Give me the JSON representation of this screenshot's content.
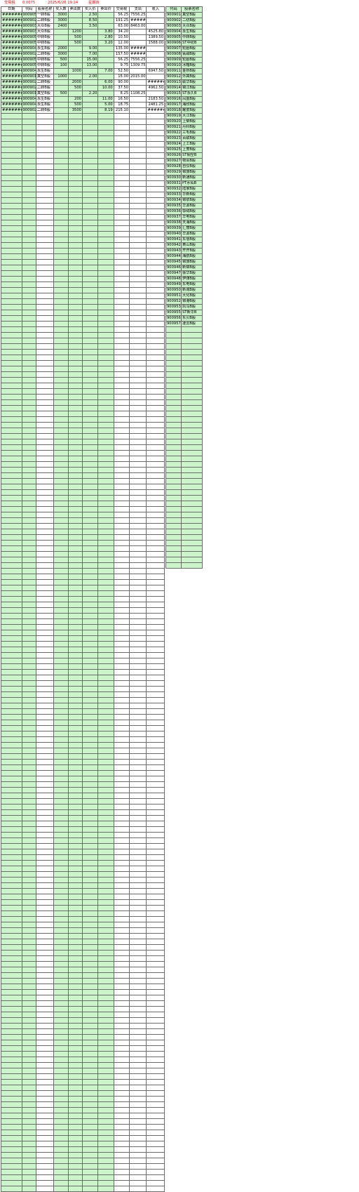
{
  "topbar": {
    "fee_label": "交易税",
    "fee_value": "0.0075",
    "datetime": "2025/6/26 19:24",
    "weekday": "星期四"
  },
  "main_sheet": {
    "headers": [
      "日期",
      "代码",
      "股票名称",
      "买入数",
      "卖出数",
      "买入价",
      "卖出价",
      "交易税",
      "支出",
      "收入"
    ],
    "rows": [
      [
        "########",
        "900905",
        "一转B股",
        "3000",
        "",
        "2.50",
        "",
        "56.25",
        "7556.25",
        ""
      ],
      [
        "########",
        "900902",
        "二转B股",
        "3000",
        "",
        "8.50",
        "",
        "191.25",
        "#######",
        ""
      ],
      [
        "########",
        "900903",
        "大众B股",
        "2400",
        "",
        "3.50",
        "",
        "63.00",
        "8463.00",
        ""
      ],
      [
        "########",
        "900903",
        "大众B股",
        "",
        "1200",
        "",
        "3.80",
        "34.20",
        "",
        "4525.80"
      ],
      [
        "########",
        "900905",
        "中转B股",
        "",
        "500",
        "",
        "2.80",
        "10.50",
        "",
        "1389.50"
      ],
      [
        "########",
        "900905",
        "中转B股",
        "",
        "500",
        "",
        "3.20",
        "12.00",
        "",
        "1588.00"
      ],
      [
        "########",
        "900904",
        "永生B股",
        "2000",
        "",
        "9.00",
        "",
        "135.00",
        "#######",
        ""
      ],
      [
        "########",
        "900902",
        "二转B股",
        "3000",
        "",
        "7.00",
        "",
        "157.50",
        "#######",
        ""
      ],
      [
        "########",
        "900905",
        "中转B股",
        "500",
        "",
        "15.00",
        "",
        "56.25",
        "7556.25",
        ""
      ],
      [
        "########",
        "900905",
        "中转B股",
        "100",
        "",
        "13.00",
        "",
        "9.75",
        "1309.75",
        ""
      ],
      [
        "########",
        "900904",
        "永生B股",
        "",
        "1000",
        "",
        "7.00",
        "52.50",
        "",
        "6947.50"
      ],
      [
        "########",
        "900901",
        "真空B股",
        "1000",
        "",
        "2.00",
        "",
        "15.00",
        "2015.00",
        ""
      ],
      [
        "########",
        "900902",
        "二转B股",
        "",
        "2000",
        "",
        "6.00",
        "90.00",
        "",
        "#######"
      ],
      [
        "########",
        "900902",
        "二转B股",
        "",
        "500",
        "",
        "10.00",
        "37.50",
        "",
        "4962.50"
      ],
      [
        "########",
        "900901",
        "真空B股",
        "500",
        "",
        "2.20",
        "",
        "8.25",
        "1108.25",
        ""
      ],
      [
        "########",
        "900904",
        "永生B股",
        "",
        "200",
        "",
        "11.00",
        "16.50",
        "",
        "2183.50"
      ],
      [
        "########",
        "900904",
        "永生B股",
        "",
        "500",
        "",
        "5.00",
        "18.75",
        "",
        "2481.25"
      ],
      [
        "########",
        "900902",
        "二转B股",
        "",
        "3500",
        "",
        "8.19",
        "215.10",
        "",
        "#######"
      ]
    ]
  },
  "code_sheet": {
    "headers": [
      "代码",
      "股票名称"
    ],
    "rows": [
      [
        "900901",
        "真空B股"
      ],
      [
        "900902",
        "二纺B股"
      ],
      [
        "900903",
        "大众B股"
      ],
      [
        "900904",
        "永生B股"
      ],
      [
        "900905",
        "中转B股"
      ],
      [
        "900906",
        "ST中纺B"
      ],
      [
        "900907",
        "轮胎B股"
      ],
      [
        "900908",
        "氯碱B股"
      ],
      [
        "900909",
        "轮胎B股"
      ],
      [
        "900910",
        "冰箱B股"
      ],
      [
        "900911",
        "金桥B股"
      ],
      [
        "900912",
        "外高B股"
      ],
      [
        "900913",
        "联华B股"
      ],
      [
        "900914",
        "锦江B股"
      ],
      [
        "900915",
        "ST永久B"
      ],
      [
        "900916",
        "凤凰B股"
      ],
      [
        "900917",
        "海欣B股"
      ],
      [
        "900918",
        "耀皮B股"
      ],
      [
        "900919",
        "大江B股"
      ],
      [
        "900920",
        "上柴B股"
      ],
      [
        "900921",
        "丹科B股"
      ],
      [
        "900922",
        "三毛B股"
      ],
      [
        "900923",
        "百联B股"
      ],
      [
        "900924",
        "上工B股"
      ],
      [
        "900925",
        "上菱B股"
      ],
      [
        "900926",
        "ST钢空B"
      ],
      [
        "900927",
        "物贸B股"
      ],
      [
        "900928",
        "自仪B股"
      ],
      [
        "900929",
        "锦旅B股"
      ],
      [
        "900930",
        "新通B股"
      ],
      [
        "900931",
        "PT水仙B"
      ],
      [
        "900932",
        "陆家B股"
      ],
      [
        "900933",
        "华新B股"
      ],
      [
        "900934",
        "锦浆B股"
      ],
      [
        "900935",
        "华源B股"
      ],
      [
        "900936",
        "鄂绒B股"
      ],
      [
        "900937",
        "华电B股"
      ],
      [
        "900938",
        "天海B股"
      ],
      [
        "900939",
        "汇丽B股"
      ],
      [
        "900940",
        "华源B股"
      ],
      [
        "900941",
        "东信B股"
      ],
      [
        "900942",
        "黄山B股"
      ],
      [
        "900943",
        "开开B股"
      ],
      [
        "900944",
        "海航B股"
      ],
      [
        "900945",
        "锦旅B股"
      ],
      [
        "900946",
        "新锦B股"
      ],
      [
        "900947",
        "振华B股"
      ],
      [
        "900948",
        "伊煤B股"
      ],
      [
        "900949",
        "东电B股"
      ],
      [
        "900950",
        "新城B股"
      ],
      [
        "900951",
        "大化B股"
      ],
      [
        "900952",
        "锦港B股"
      ],
      [
        "900953",
        "凯马B股"
      ],
      [
        "900955",
        "ST新华B"
      ],
      [
        "900956",
        "东贝B股"
      ],
      [
        "900957",
        "凌云B股"
      ]
    ]
  },
  "colors": {
    "cell_green": "#ccf5cc",
    "title_red": "#cc1111",
    "grid": "#6b6b6b"
  }
}
